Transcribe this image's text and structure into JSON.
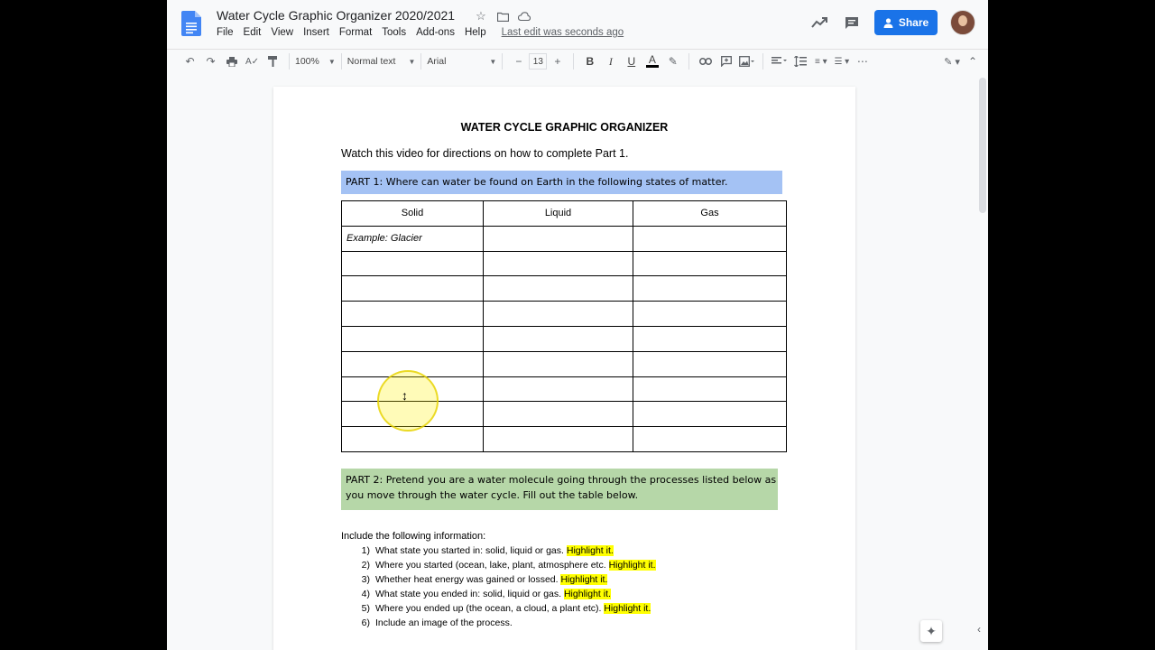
{
  "header": {
    "title": "Water Cycle Graphic Organizer 2020/2021",
    "menu": [
      "File",
      "Edit",
      "View",
      "Insert",
      "Format",
      "Tools",
      "Add-ons",
      "Help"
    ],
    "last_edit": "Last edit was seconds ago",
    "share_label": "Share"
  },
  "toolbar": {
    "zoom": "100%",
    "style": "Normal text",
    "font": "Arial",
    "font_size": "13",
    "minus": "−",
    "plus": "+"
  },
  "document": {
    "title": "WATER CYCLE GRAPHIC ORGANIZER",
    "intro": "Watch this video for directions on how to complete Part 1.",
    "part1": "PART 1: Where can water be found on Earth in the following states of matter.",
    "table_headers": [
      "Solid",
      "Liquid",
      "Gas"
    ],
    "example": "Example: Glacier",
    "part2": "PART 2: Pretend you are a water molecule going through the processes listed below as you move through the water cycle.  Fill out the table below.",
    "include_label": "Include the following information:",
    "steps": [
      {
        "num": "1)",
        "text": "What state you started in: solid, liquid or gas. ",
        "hl": "Highlight it."
      },
      {
        "num": "2)",
        "text": "Where you started (ocean, lake, plant, atmosphere etc. ",
        "hl": "Highlight it."
      },
      {
        "num": "3)",
        "text": "Whether heat energy was gained or lossed. ",
        "hl": "Highlight it."
      },
      {
        "num": "4)",
        "text": "What state you ended in: solid, liquid or gas. ",
        "hl": "Highlight it."
      },
      {
        "num": "5)",
        "text": "Where you ended up (the ocean, a cloud, a plant etc). ",
        "hl": "Highlight it."
      },
      {
        "num": "6)",
        "text": "Include an image of the process.",
        "hl": ""
      }
    ]
  },
  "colors": {
    "share_blue": "#1a73e8",
    "part1_bg": "#a4c2f4",
    "part2_bg": "#b6d7a8",
    "highlight": "#ffff00"
  }
}
